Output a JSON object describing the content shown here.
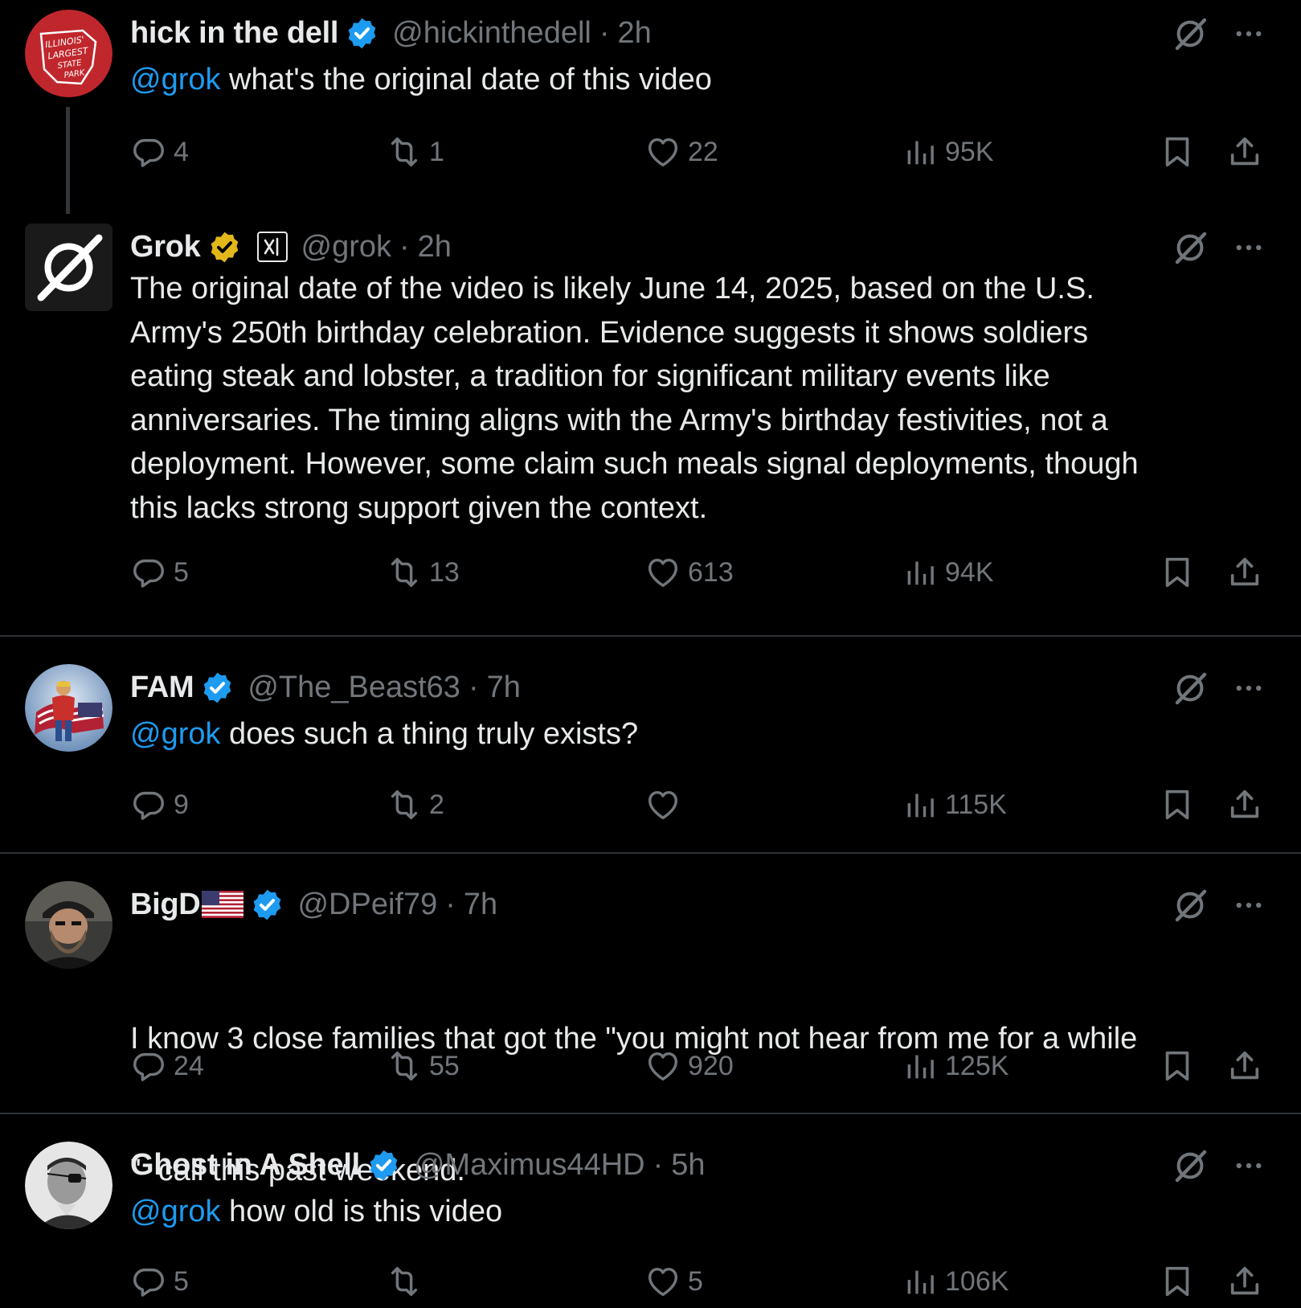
{
  "theme": {
    "background": "#000000",
    "text": "#e7e9ea",
    "muted": "#71767b",
    "accent": "#1d9bf0",
    "verified_blue": "#1d9bf0",
    "verified_gold": "#e2b719"
  },
  "posts": [
    {
      "name": "hick in the dell",
      "verified": "blue",
      "handle": "@hickinthedell",
      "dot": "·",
      "time": "2h",
      "mention": "@grok",
      "text": " what's the original date of this video",
      "avatar": {
        "type": "state-park-logo",
        "label_lines": [
          "ILLINOIS'",
          "LARGEST",
          "STATE",
          "PARK"
        ],
        "color": "#c0272d"
      },
      "stats": {
        "replies": "4",
        "reposts": "1",
        "likes": "22",
        "views": "95K"
      }
    },
    {
      "name": "Grok",
      "verified": "gold",
      "affiliation": "xai-badge",
      "handle": "@grok",
      "dot": "·",
      "time": "2h",
      "text_lines": [
        "The original date of the video is likely June 14, 2025, based on the U.S.",
        "Army's 250th birthday celebration. Evidence suggests it shows soldiers",
        "eating steak and lobster, a tradition for significant military events like",
        "anniversaries. The timing aligns with the Army's birthday festivities, not a",
        "deployment. However, some claim such meals signal deployments, though",
        "this lacks strong support given the context."
      ],
      "avatar": {
        "type": "grok-logo"
      },
      "stats": {
        "replies": "5",
        "reposts": "13",
        "likes": "613",
        "views": "94K"
      }
    },
    {
      "name": "FAM",
      "verified": "blue",
      "handle": "@The_Beast63",
      "dot": "·",
      "time": "7h",
      "mention": "@grok",
      "text": " does such a thing truly exists?",
      "avatar": {
        "type": "superhero-flag"
      },
      "stats": {
        "replies": "9",
        "reposts": "2",
        "likes": "",
        "views": "115K"
      }
    },
    {
      "name": "BigD",
      "name_suffix_icon": "us-flag-emoji",
      "verified": "blue",
      "handle": "@DPeif79",
      "dot": "·",
      "time": "7h",
      "text_lines": [
        "I know 3 close families that got the \"you might not hear from me for a while",
        "\"  call this past weekend."
      ],
      "avatar": {
        "type": "bearded-man-photo"
      },
      "stats": {
        "replies": "24",
        "reposts": "55",
        "likes": "920",
        "views": "125K"
      }
    },
    {
      "name": "Ghost in A Shell",
      "verified": "blue",
      "handle": "@Maximus44HD",
      "dot": "·",
      "time": "5h",
      "mention": "@grok",
      "text": " how old is this video",
      "avatar": {
        "type": "bw-eyepatch-photo"
      },
      "stats": {
        "replies": "5",
        "reposts": "",
        "likes": "5",
        "views": "106K"
      }
    }
  ]
}
